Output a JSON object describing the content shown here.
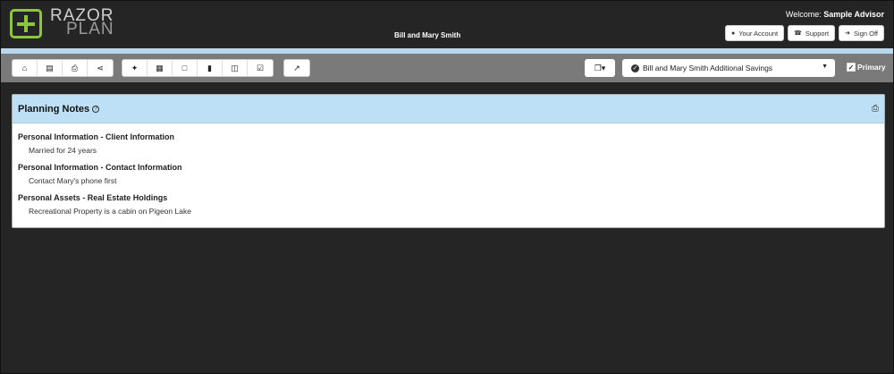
{
  "header": {
    "logo_line1": "RAZOR",
    "logo_line2": "PLAN",
    "client_name": "Bill and Mary Smith",
    "welcome_label": "Welcome:",
    "user_name": "Sample Advisor",
    "buttons": {
      "account": "Your Account",
      "support": "Support",
      "signoff": "Sign Off"
    }
  },
  "toolbar": {
    "scenario_selected": "Bill and Mary Smith Additional Savings",
    "primary_label": "Primary",
    "primary_checked": true
  },
  "panel": {
    "title": "Planning Notes",
    "sections": [
      {
        "title": "Personal Information - Client Information",
        "note": "Married for 24 years"
      },
      {
        "title": "Personal Information - Contact Information",
        "note": "Contact Mary's phone first"
      },
      {
        "title": "Personal Assets - Real Estate Holdings",
        "note": "Recreational Property is a cabin on Pigeon Lake"
      }
    ]
  },
  "colors": {
    "brand_green": "#8cc63f",
    "header_bg": "#252525",
    "accent_blue": "#bde0f6",
    "toolbar_bg": "#7a7a7a"
  },
  "icons": [
    "home-icon",
    "save-icon",
    "print-icon",
    "share-icon",
    "wand-icon",
    "table-icon",
    "note-icon",
    "bar-chart-icon",
    "columns-icon",
    "checklist-icon",
    "line-chart-icon",
    "copy-icon",
    "help-icon"
  ]
}
